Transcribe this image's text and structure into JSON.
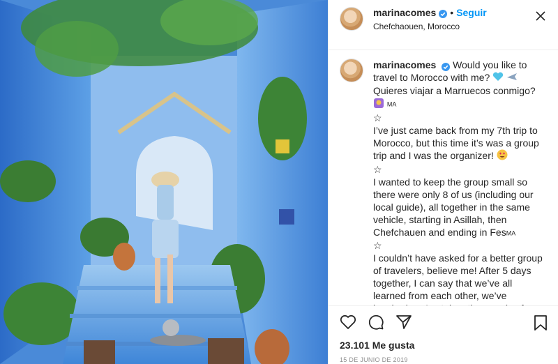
{
  "header": {
    "username": "marinacomes",
    "separator": "•",
    "follow_label": "Seguir",
    "location": "Chefchaouen, Morocco"
  },
  "caption": {
    "username": "marinacomes",
    "lines": [
      "Would you like to travel to Morocco with me?",
      "Quieres viajar a Marruecos conmigo?",
      "MA",
      "☆",
      "I’ve just came back from my 7th trip to Morocco, but this time it’s was a group trip and I was the organizer!",
      "☆",
      "I wanted to keep the group small so there were only 8 of us (including our local guide), all together in the same vehicle, starting in Asillah, then Chefchauen and ending in Fes",
      "MA",
      "☆",
      "I couldn’t have asked for a better group of travelers, believe me! After 5 days together, I can say that we’ve all learned from each other, we’ve laughed, we’ve taken thousands of"
    ]
  },
  "footer": {
    "likes": "23.101 Me gusta",
    "date": "15 DE JUNIO DE 2019"
  },
  "colors": {
    "accent": "#0095f6",
    "verified": "#3897f0",
    "text": "#262626",
    "muted": "#8e8e8e"
  },
  "icons": [
    "verified-badge-icon",
    "more-options-icon",
    "heart-icon",
    "comment-icon",
    "share-icon",
    "bookmark-icon",
    "blue-heart-emoji",
    "airplane-emoji",
    "woman-emoji",
    "heart-eyes-emoji"
  ]
}
